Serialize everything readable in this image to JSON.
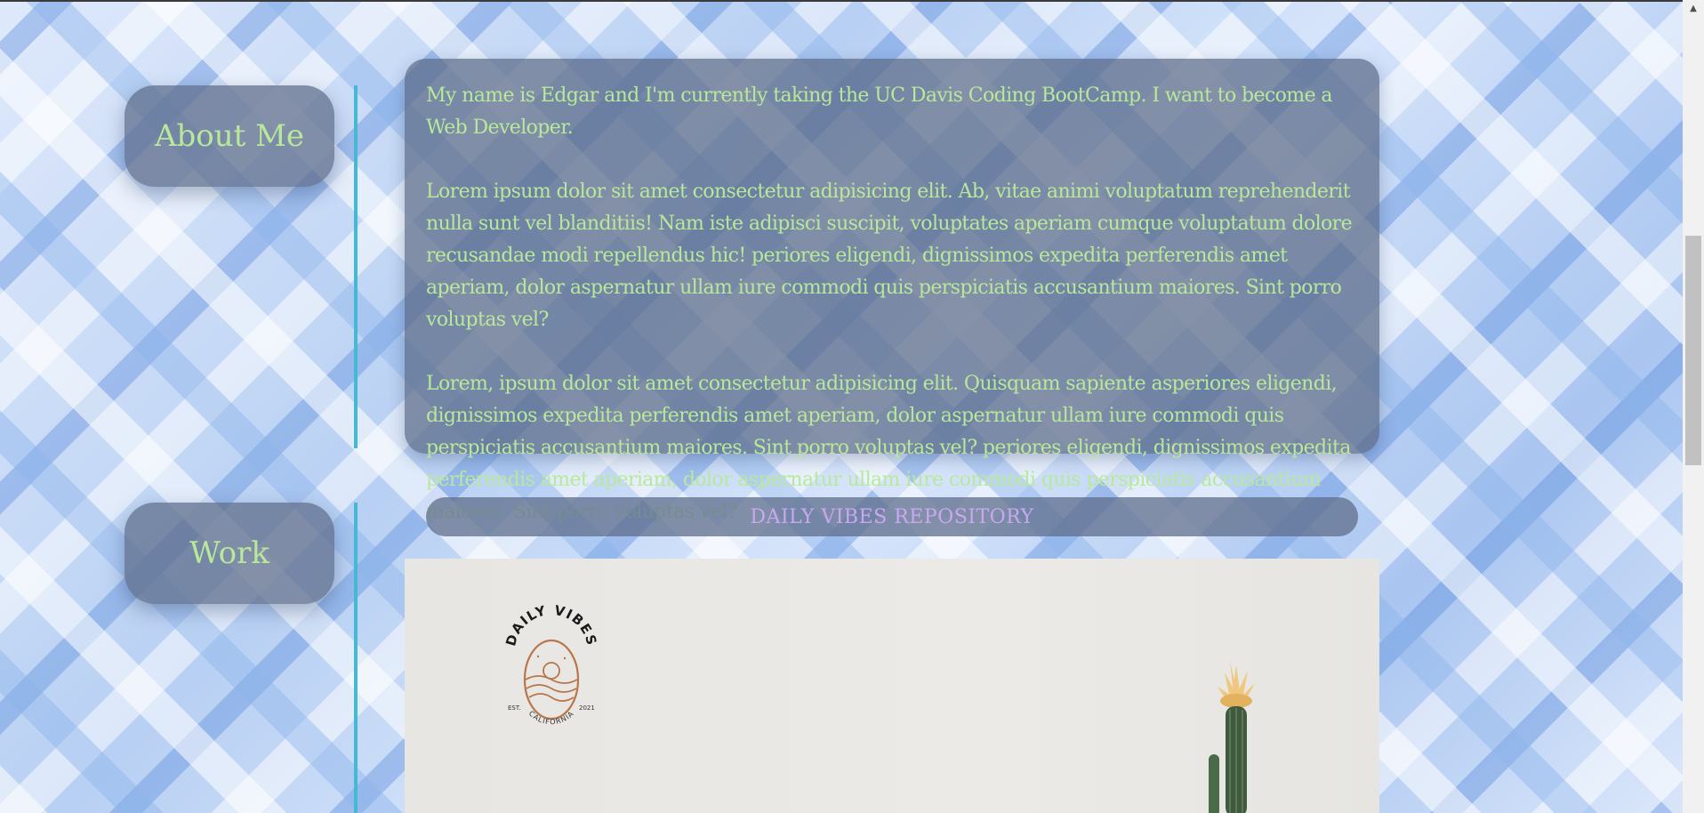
{
  "about": {
    "label": "About Me",
    "paragraphs": [
      "My name is Edgar and I'm currently taking the UC Davis Coding BootCamp. I want to become a Web Developer.",
      "Lorem ipsum dolor sit amet consectetur adipisicing elit. Ab, vitae animi voluptatum reprehenderit nulla sunt vel blanditiis! Nam iste adipisci suscipit, voluptates aperiam cumque voluptatum dolore recusandae modi repellendus hic! periores eligendi, dignissimos expedita perferendis amet aperiam, dolor aspernatur ullam iure commodi quis perspiciatis accusantium maiores. Sint porro voluptas vel?",
      "Lorem, ipsum dolor sit amet consectetur adipisicing elit. Quisquam sapiente asperiores eligendi, dignissimos expedita perferendis amet aperiam, dolor aspernatur ullam iure commodi quis perspiciatis accusantium maiores. Sint porro voluptas vel? periores eligendi, dignissimos expedita perferendis amet aperiam, dolor aspernatur ullam iure commodi quis perspiciatis accusantium maiores. Sint porro voluptas vel?"
    ]
  },
  "work": {
    "label": "Work",
    "projects": [
      {
        "title": "DAILY VIBES REPOSITORY",
        "logo_text_top": "DAILY VIBES",
        "logo_text_bottom": "CALIFORNIA",
        "logo_est": "EST.",
        "logo_year": "2021"
      }
    ]
  },
  "colors": {
    "label_text": "#b8e89a",
    "project_title_text": "#c9a8f0",
    "divider": "#45b8d4",
    "card_bg": "rgba(90,105,135,0.72)"
  },
  "icons": {
    "scroll_up": "▲"
  }
}
